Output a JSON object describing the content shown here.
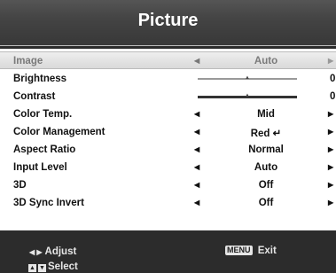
{
  "header": {
    "title": "Picture"
  },
  "menu": {
    "items": [
      {
        "label": "Image",
        "value": "Auto",
        "type": "select",
        "selected": true
      },
      {
        "label": "Brightness",
        "value": "0",
        "type": "slider",
        "level": 0.5
      },
      {
        "label": "Contrast",
        "value": "0",
        "type": "slider",
        "level": 0.5
      },
      {
        "label": "Color Temp.",
        "value": "Mid",
        "type": "select"
      },
      {
        "label": "Color Management",
        "value": "Red ↵",
        "type": "select"
      },
      {
        "label": "Aspect Ratio",
        "value": "Normal",
        "type": "select"
      },
      {
        "label": "Input Level",
        "value": "Auto",
        "type": "select"
      },
      {
        "label": "3D",
        "value": "Off",
        "type": "select"
      },
      {
        "label": "3D Sync Invert",
        "value": "Off",
        "type": "select"
      }
    ]
  },
  "footer": {
    "adjust_label": "Adjust",
    "menu_key": "MENU",
    "exit_label": "Exit",
    "select_label": "Select"
  }
}
